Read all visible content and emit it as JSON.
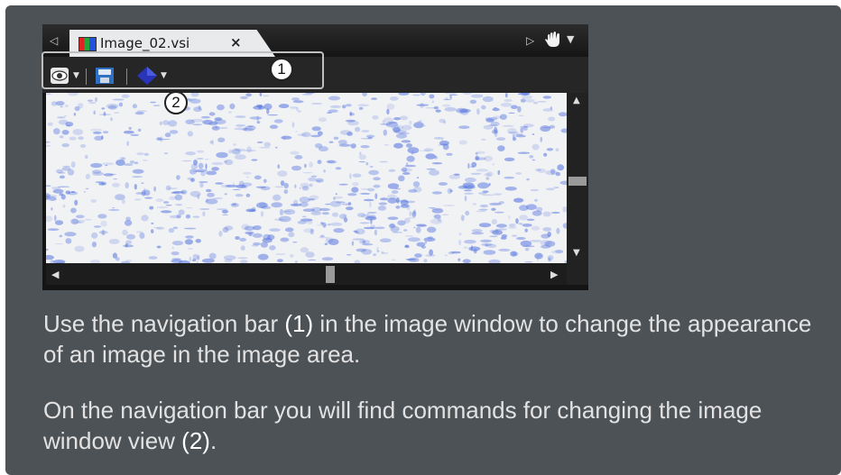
{
  "image_window": {
    "tab": {
      "label": "Image_02.vsi",
      "close": "×"
    },
    "callouts": {
      "navigation_bar": "1",
      "view_commands": "2"
    }
  },
  "text": {
    "p1_before": "Use the navigation bar ",
    "p1_ref": "(1)",
    "p1_after": " in the image window to change the appearance of an image in the image area.",
    "p2_before": "On the navigation bar you will find commands for changing the image window view ",
    "p2_ref": "(2)",
    "p2_after": "."
  },
  "colors": {
    "panel": "#4d5256",
    "tab": "#e9eaec",
    "image_stain": "#5a78e0"
  }
}
